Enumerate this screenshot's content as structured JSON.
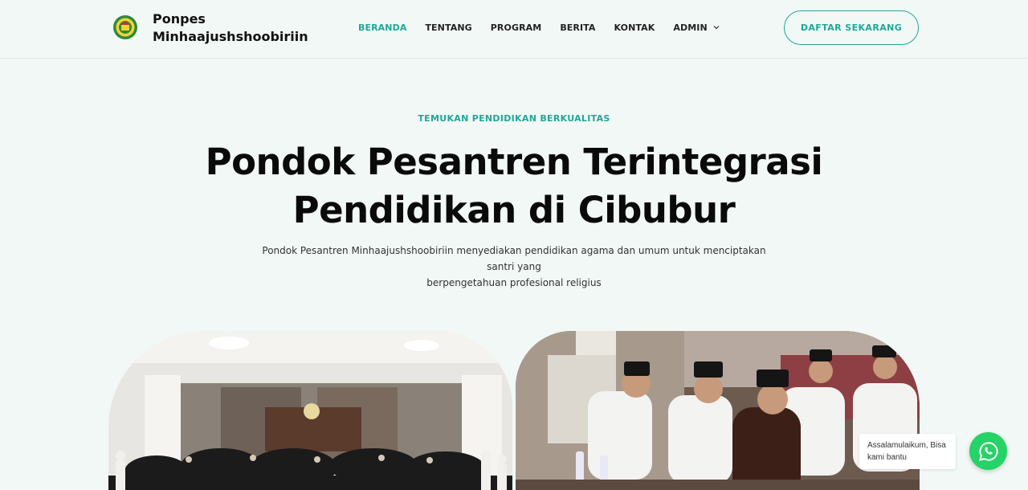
{
  "header": {
    "brand_line1": "Ponpes",
    "brand_line2": "Minhaajushshoobiriin",
    "logo_icon": "pesantren-emblem-icon",
    "nav": [
      {
        "label": "BERANDA",
        "active": true
      },
      {
        "label": "TENTANG",
        "active": false
      },
      {
        "label": "PROGRAM",
        "active": false
      },
      {
        "label": "BERITA",
        "active": false
      },
      {
        "label": "KONTAK",
        "active": false
      },
      {
        "label": "ADMIN",
        "active": false,
        "has_dropdown": true
      }
    ],
    "cta_label": "DAFTAR SEKARANG"
  },
  "hero": {
    "eyebrow": "TEMUKAN PENDIDIKAN BERKUALITAS",
    "title_line1": "Pondok Pesantren Terintegrasi",
    "title_line2": "Pendidikan di Cibubur",
    "subtitle_line1": "Pondok Pesantren Minhaajushshoobiriin menyediakan pendidikan agama dan umum untuk menciptakan santri yang",
    "subtitle_line2": "berpengetahuan profesional religius"
  },
  "whatsapp": {
    "message": "Assalamulaikum, Bisa kami bantu",
    "icon": "whatsapp-icon"
  },
  "colors": {
    "accent": "#1fa89a",
    "background": "#f2f8f5",
    "whatsapp": "#25d366"
  }
}
